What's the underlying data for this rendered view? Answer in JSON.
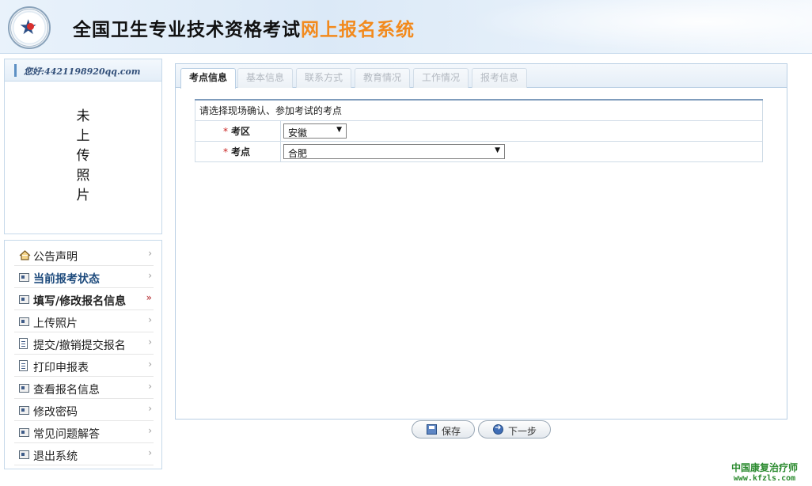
{
  "header": {
    "title_main": "全国卫生专业技术资格考试",
    "title_accent": "网上报名系统"
  },
  "user": {
    "greeting": "您好:4421198920qq.com",
    "photo_placeholder": [
      "未",
      "上",
      "传",
      "照",
      "片"
    ]
  },
  "nav": {
    "items": [
      {
        "label": "公告声明",
        "icon": "house-icon"
      },
      {
        "label": "当前报考状态",
        "icon": "card-icon"
      },
      {
        "label": "填写/修改报名信息",
        "icon": "card-icon"
      },
      {
        "label": "上传照片",
        "icon": "card-icon"
      },
      {
        "label": "提交/撤销提交报名",
        "icon": "document-icon"
      },
      {
        "label": "打印申报表",
        "icon": "document-icon"
      },
      {
        "label": "查看报名信息",
        "icon": "card-icon"
      },
      {
        "label": "修改密码",
        "icon": "card-icon"
      },
      {
        "label": "常见问题解答",
        "icon": "card-icon"
      },
      {
        "label": "退出系统",
        "icon": "card-icon"
      }
    ],
    "chevron": "›",
    "chevron_active": "»"
  },
  "tabs": [
    "考点信息",
    "基本信息",
    "联系方式",
    "教育情况",
    "工作情况",
    "报考信息"
  ],
  "form": {
    "instruction": "请选择现场确认、参加考试的考点",
    "required_mark": "*",
    "fields": [
      {
        "label": "考区",
        "value": "安徽"
      },
      {
        "label": "考点",
        "value": "合肥"
      }
    ]
  },
  "buttons": {
    "save": "保存",
    "next": "下一步"
  },
  "watermark": {
    "line1": "中国康复治疗师",
    "line2": "www.kfzls.com"
  },
  "colors": {
    "accent_title": "#f28a1d",
    "required": "#c8201e",
    "nav_active": "#1d4a7c",
    "watermark": "#2a8a2e"
  }
}
